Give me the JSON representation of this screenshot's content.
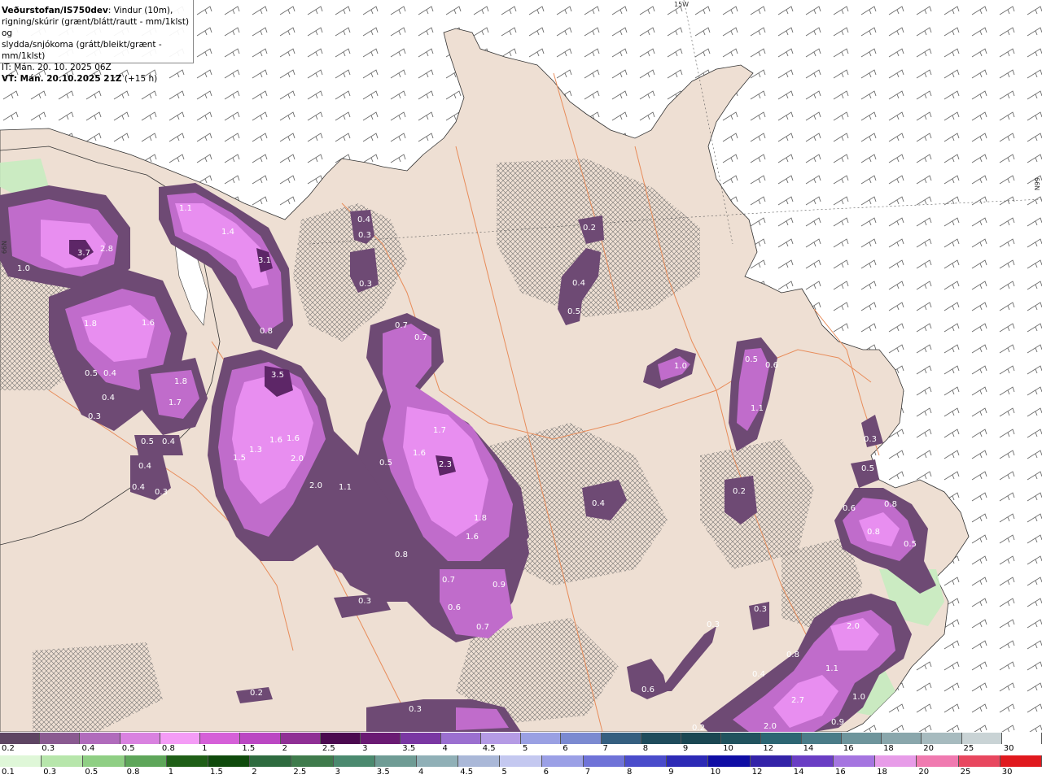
{
  "header": {
    "source": "Veðurstofan/IS750dev",
    "line1": ": Vindur (10m),",
    "line2": "rigning/skúrir (grænt/blátt/rautt - mm/1klst) og",
    "line3": "slydda/snjókoma (grátt/bleikt/grænt - mm/1klst)",
    "issue_time": "IT: Mán. 20. 10. 2025 06Z",
    "valid_time": "VT: Mán. 20.10.2025 21Z",
    "lead_time": "(+15 h)"
  },
  "coords": {
    "top_lon": "15W",
    "right_lat": "66N",
    "left_lat": "66N"
  },
  "map_values": [
    {
      "label": "3.7"
    },
    {
      "label": "2.8"
    },
    {
      "label": "1.0"
    },
    {
      "label": "1.1"
    },
    {
      "label": "1.4"
    },
    {
      "label": "3.1"
    },
    {
      "label": "1.8"
    },
    {
      "label": "1.6"
    },
    {
      "label": "0.5"
    },
    {
      "label": "0.4"
    },
    {
      "label": "0.4"
    },
    {
      "label": "0.3"
    },
    {
      "label": "1.8"
    },
    {
      "label": "1.7"
    },
    {
      "label": "0.5"
    },
    {
      "label": "0.4"
    },
    {
      "label": "0.4"
    },
    {
      "label": "0.4"
    },
    {
      "label": "0.3"
    },
    {
      "label": "0.8"
    },
    {
      "label": "3.5"
    },
    {
      "label": "1.5"
    },
    {
      "label": "1.3"
    },
    {
      "label": "1.6"
    },
    {
      "label": "1.6"
    },
    {
      "label": "2.0"
    },
    {
      "label": "2.0"
    },
    {
      "label": "1.1"
    },
    {
      "label": "0.4"
    },
    {
      "label": "0.3"
    },
    {
      "label": "0.3"
    },
    {
      "label": "0.7"
    },
    {
      "label": "0.7"
    },
    {
      "label": "1.7"
    },
    {
      "label": "1.6"
    },
    {
      "label": "2.3"
    },
    {
      "label": "0.5"
    },
    {
      "label": "1.8"
    },
    {
      "label": "1.6"
    },
    {
      "label": "0.8"
    },
    {
      "label": "0.7"
    },
    {
      "label": "0.9"
    },
    {
      "label": "0.6"
    },
    {
      "label": "0.7"
    },
    {
      "label": "0.3"
    },
    {
      "label": "0.2"
    },
    {
      "label": "0.4"
    },
    {
      "label": "0.5"
    },
    {
      "label": "1.0"
    },
    {
      "label": "0.5"
    },
    {
      "label": "0.6"
    },
    {
      "label": "1.1"
    },
    {
      "label": "0.4"
    },
    {
      "label": "0.2"
    },
    {
      "label": "0.3"
    },
    {
      "label": "0.3"
    },
    {
      "label": "0.5"
    },
    {
      "label": "0.6"
    },
    {
      "label": "0.8"
    },
    {
      "label": "0.8"
    },
    {
      "label": "0.5"
    },
    {
      "label": "0.3"
    },
    {
      "label": "2.0"
    },
    {
      "label": "0.8"
    },
    {
      "label": "1.1"
    },
    {
      "label": "0.4"
    },
    {
      "label": "2.7"
    },
    {
      "label": "1.0"
    },
    {
      "label": "2.0"
    },
    {
      "label": "0.6"
    },
    {
      "label": "0.2"
    },
    {
      "label": "0.3"
    },
    {
      "label": "0.2"
    },
    {
      "label": "0.9"
    }
  ],
  "legend_snow": {
    "labels": [
      "0.2",
      "0.3",
      "0.4",
      "0.5",
      "0.8",
      "1",
      "1.5",
      "2",
      "2.5",
      "3",
      "3.5",
      "4",
      "4.5",
      "5",
      "6",
      "7",
      "8",
      "9",
      "10",
      "12",
      "14",
      "16",
      "18",
      "20",
      "25",
      "30"
    ],
    "colors": [
      "#5e4563",
      "#8a5a91",
      "#b06bbc",
      "#d982e0",
      "#f49cf6",
      "#d560d8",
      "#bb47c3",
      "#8f2f95",
      "#4b0a50",
      "#6a1b73",
      "#7a37a3",
      "#9b6fd0",
      "#b59be5",
      "#9aa0e3",
      "#7b8ad1",
      "#355f80",
      "#1f4c5c",
      "#1b4752",
      "#21535e",
      "#2d6673",
      "#4a7c88",
      "#6e959c",
      "#8aa7ac",
      "#a7bbbf",
      "#c9d3d5",
      "#ffffff"
    ]
  },
  "legend_rain": {
    "labels": [
      "0.1",
      "0.3",
      "0.5",
      "0.8",
      "1",
      "1.5",
      "2",
      "2.5",
      "3",
      "3.5",
      "4",
      "4.5",
      "5",
      "6",
      "7",
      "8",
      "9",
      "10",
      "12",
      "14",
      "16",
      "18",
      "20",
      "25",
      "30"
    ],
    "colors": [
      "#dff7d8",
      "#b7e6ab",
      "#8fcf84",
      "#5ea65a",
      "#1f5f17",
      "#0f4a0c",
      "#2e6b3f",
      "#3f7b4c",
      "#4b8a6f",
      "#6f9c95",
      "#90b0b7",
      "#aab8d8",
      "#c4c8f0",
      "#9ba0e6",
      "#6f73d8",
      "#4a4ccb",
      "#2d2ab6",
      "#0f0da4",
      "#3323a8",
      "#6a3ec4",
      "#a575e0",
      "#e79ce8",
      "#f07ab0",
      "#e8475f",
      "#e0191e"
    ]
  }
}
